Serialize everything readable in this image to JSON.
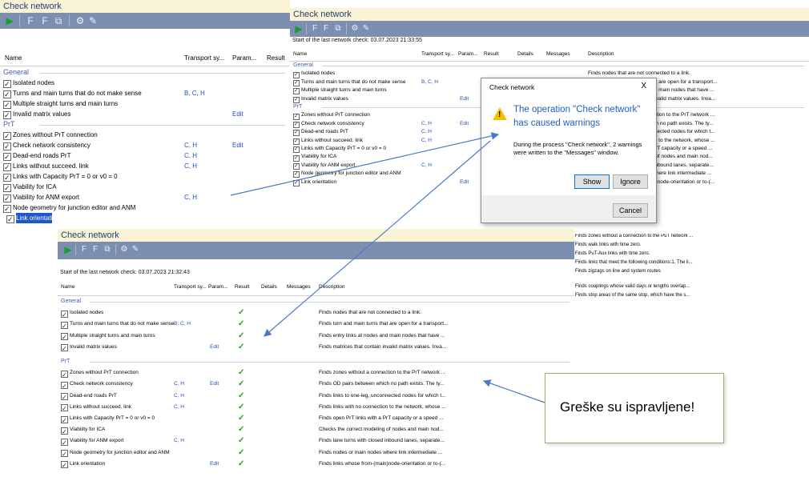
{
  "window_title": "Check network",
  "w1": {
    "columns": [
      "Name",
      "Transport sy...",
      "Param...",
      "Result"
    ],
    "groups": [
      "General",
      "PrT"
    ],
    "general_rows": [
      {
        "name": "Isolated nodes",
        "ts": "",
        "param": ""
      },
      {
        "name": "Turns and main turns that do not make sense",
        "ts": "B, C, H",
        "param": ""
      },
      {
        "name": "Multiple straight turns and main turns",
        "ts": "",
        "param": ""
      },
      {
        "name": "Invalid matrix values",
        "ts": "",
        "param": "Edit"
      }
    ],
    "prt_rows": [
      {
        "name": "Zones without PrT connection",
        "ts": "",
        "param": ""
      },
      {
        "name": "Check network consistency",
        "ts": "C, H",
        "param": "Edit"
      },
      {
        "name": "Dead-end roads PrT",
        "ts": "C, H",
        "param": ""
      },
      {
        "name": "Links without succeed. link",
        "ts": "C, H",
        "param": ""
      },
      {
        "name": "Links with Capacity PrT = 0 or v0 = 0",
        "ts": "",
        "param": ""
      },
      {
        "name": "Viability for ICA",
        "ts": "",
        "param": ""
      },
      {
        "name": "Viability for ANM export",
        "ts": "C, H",
        "param": ""
      },
      {
        "name": "Node geometry for junction editor and ANM",
        "ts": "",
        "param": ""
      },
      {
        "name": "Link orientati",
        "ts": "",
        "param": ""
      }
    ]
  },
  "w2": {
    "status": "Start of the last network check: 03.07.2023 21:33:55",
    "columns": [
      "Name",
      "Transport sy...",
      "Param...",
      "Result",
      "Details",
      "Messages",
      "Description"
    ],
    "groups": [
      "General",
      "PrT"
    ],
    "general_rows": [
      {
        "name": "Isolated nodes",
        "ts": "",
        "param": "",
        "desc": "Finds nodes that are not connected to a link."
      },
      {
        "name": "Turns and main turns that do not make sense",
        "ts": "B, C, H",
        "param": "",
        "desc": "Finds turn and main turns that are open for a transport..."
      },
      {
        "name": "Multiple straight turns and main turns",
        "ts": "",
        "param": "",
        "desc": "Finds entry links at nodes and main nodes that have ..."
      },
      {
        "name": "Invalid matrix values",
        "ts": "",
        "param": "Edit",
        "desc": "Finds matrices that contain invalid matrix values. Inva..."
      }
    ],
    "prt_rows": [
      {
        "name": "Zones without PrT connection",
        "ts": "",
        "param": "",
        "desc": "Finds zones without a connection to the PrT network ..."
      },
      {
        "name": "Check network consistency",
        "ts": "C, H",
        "param": "Edit",
        "desc": "Finds OD pairs between which no path exists. The ty..."
      },
      {
        "name": "Dead-end roads PrT",
        "ts": "C, H",
        "param": "",
        "desc": "Finds links to one-leg, unconnected nodes for which t..."
      },
      {
        "name": "Links without succeed. link",
        "ts": "C, H",
        "param": "",
        "desc": "Finds links with no connection to the network, whose ..."
      },
      {
        "name": "Links with Capacity PrT = 0 or v0 = 0",
        "ts": "",
        "param": "",
        "desc": "Finds open PrT links with a PrT capacity or a speed ..."
      },
      {
        "name": "Viability for ICA",
        "ts": "",
        "param": "",
        "desc": "Checks the correct modeling of nodes and main nod..."
      },
      {
        "name": "Viability for ANM export",
        "ts": "C, H",
        "param": "",
        "desc": "Finds lane turns with closed inbound lanes, separate..."
      },
      {
        "name": "Node geometry for junction editor and ANM",
        "ts": "",
        "param": "",
        "desc": "Finds nodes or main nodes where link intermediate ..."
      },
      {
        "name": "Link orientation",
        "ts": "",
        "param": "Edit",
        "desc": "Finds links whose from-(main)node-orientation or to-(..."
      }
    ],
    "extra_desc": [
      "Finds zones without a connection to the PuT network ...",
      "Finds walk links with time zero.",
      "Finds PuT-Aux links with time zero.",
      "Finds links that meet the following conditions:1. The li...",
      "Finds zigzags on line and system routes",
      "Finds couplings whose valid days or lengths overlap...",
      "Finds stop areas of the same stop, which have the s..."
    ]
  },
  "dialog": {
    "title": "Check network",
    "close": "X",
    "heading": "The operation \"Check network\" has caused warnings",
    "message": "During the process \"Check network\", 2 warnings were written to the \"Messages\" window.",
    "show": "Show",
    "ignore": "Ignore",
    "cancel": "Cancel"
  },
  "w3": {
    "status": "Start of the last network check: 03.07.2023 21:32:43",
    "columns": [
      "Name",
      "Transport sy...",
      "Param...",
      "Result",
      "Details",
      "Messages",
      "Description"
    ],
    "groups": [
      "General",
      "PrT"
    ],
    "general_rows": [
      {
        "name": "Isolated nodes",
        "ts": "",
        "param": "",
        "result": "✓",
        "desc": "Finds nodes that are not connected to a link."
      },
      {
        "name": "Turns and main turns that do not make sense",
        "ts": "B, C, H",
        "param": "",
        "result": "✓",
        "desc": "Finds turn and main turns that are open for a transport..."
      },
      {
        "name": "Multiple straight turns and main turns",
        "ts": "",
        "param": "",
        "result": "✓",
        "desc": "Finds entry links at nodes and main nodes that have ..."
      },
      {
        "name": "Invalid matrix values",
        "ts": "",
        "param": "Edit",
        "result": "✓",
        "desc": "Finds matrices that contain invalid matrix values. Inva..."
      }
    ],
    "prt_rows": [
      {
        "name": "Zones without PrT connection",
        "ts": "",
        "param": "",
        "result": "✓",
        "desc": "Finds zones without a connection to the PrT network ..."
      },
      {
        "name": "Check network consistency",
        "ts": "C, H",
        "param": "Edit",
        "result": "✓",
        "desc": "Finds OD pairs between which no path exists. The ty..."
      },
      {
        "name": "Dead-end roads PrT",
        "ts": "C, H",
        "param": "",
        "result": "✓",
        "desc": "Finds links to one-leg, unconnected nodes for which t..."
      },
      {
        "name": "Links without succeed. link",
        "ts": "C, H",
        "param": "",
        "result": "✓",
        "desc": "Finds links with no connection to the network, whose ..."
      },
      {
        "name": "Links with Capacity PrT = 0 or v0 = 0",
        "ts": "",
        "param": "",
        "result": "✓",
        "desc": "Finds open PrT links with a PrT capacity or a speed ..."
      },
      {
        "name": "Viability for ICA",
        "ts": "",
        "param": "",
        "result": "✓",
        "desc": "Checks the correct modeling of nodes and main nod..."
      },
      {
        "name": "Viability for ANM export",
        "ts": "C, H",
        "param": "",
        "result": "✓",
        "desc": "Finds lane turns with closed inbound lanes, separate..."
      },
      {
        "name": "Node geometry for junction editor and ANM",
        "ts": "",
        "param": "",
        "result": "✓",
        "desc": "Finds nodes or main nodes where link intermediate ..."
      },
      {
        "name": "Link orientation",
        "ts": "",
        "param": "Edit",
        "result": "✓",
        "desc": "Finds links whose from-(main)node-orientation or to-(..."
      }
    ]
  },
  "callout": {
    "text": "Greške su ispravljene!"
  },
  "toolbar_icons": [
    "play-icon",
    "check-filter-icon",
    "check-filter-2-icon",
    "copy-icon",
    "settings-icon",
    "wrench-icon"
  ],
  "colors": {
    "titlebar": "#fbf3d6",
    "toolbar": "#7c8fb1",
    "group": "#3a5ea8",
    "link_blue": "#1f4fb8",
    "ok_green": "#2a9d23",
    "warning_yellow": "#f2c200",
    "dialog_heading": "#1f5fbf",
    "callout_border": "#8fb46a",
    "arrow": "#4a7bc4"
  }
}
